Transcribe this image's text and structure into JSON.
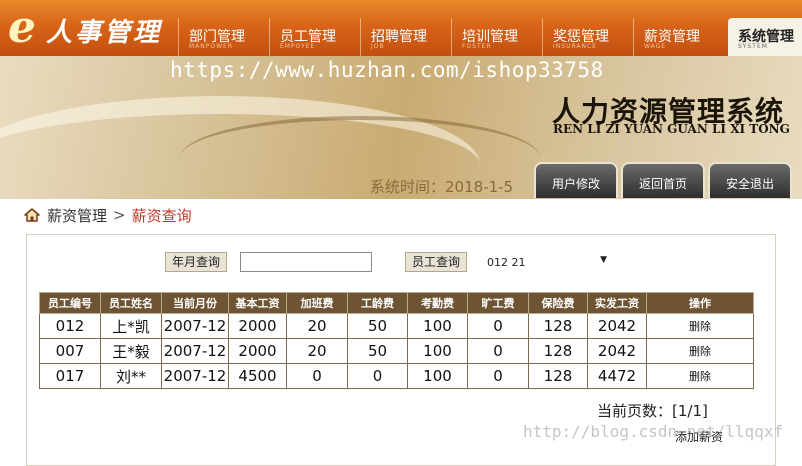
{
  "logo": {
    "e": "e",
    "text": "人事管理"
  },
  "nav": [
    {
      "cn": "部门管理",
      "en": "MANPOWER"
    },
    {
      "cn": "员工管理",
      "en": "EMPOYEE"
    },
    {
      "cn": "招聘管理",
      "en": "JOB"
    },
    {
      "cn": "培训管理",
      "en": "FOSTER"
    },
    {
      "cn": "奖惩管理",
      "en": "INSURANCE"
    },
    {
      "cn": "薪资管理",
      "en": "WAGE"
    },
    {
      "cn": "系统管理",
      "en": "SYSTEM"
    }
  ],
  "banner": {
    "watermark": "https://www.huzhan.com/ishop33758",
    "title": "人力资源管理系统",
    "pinyin": "REN LI ZI YUAN GUAN LI XI TONG",
    "time_label": "系统时间：",
    "time_value": "2018-1-5",
    "buttons": [
      "用户修改",
      "返回首页",
      "安全退出"
    ]
  },
  "breadcrumb": {
    "parent": "薪资管理",
    "sep": ">",
    "current": "薪资查询"
  },
  "search": {
    "month_btn": "年月查询",
    "month_value": "",
    "emp_btn": "员工查询",
    "emp_select": "012  21"
  },
  "table": {
    "headers": [
      "员工编号",
      "员工姓名",
      "当前月份",
      "基本工资",
      "加班费",
      "工龄费",
      "考勤费",
      "旷工费",
      "保险费",
      "实发工资",
      "操作"
    ],
    "rows": [
      [
        "012",
        "上*凯",
        "2007-12",
        "2000",
        "20",
        "50",
        "100",
        "0",
        "128",
        "2042",
        "删除"
      ],
      [
        "007",
        "王*毅",
        "2007-12",
        "2000",
        "20",
        "50",
        "100",
        "0",
        "128",
        "2042",
        "删除"
      ],
      [
        "017",
        "刘**",
        "2007-12",
        "4500",
        "0",
        "0",
        "100",
        "0",
        "128",
        "4472",
        "删除"
      ]
    ]
  },
  "page_info": "当前页数：[1/1]",
  "add_link": "添加薪资",
  "footer_watermark": "http://blog.csdn.net/llqqxf"
}
